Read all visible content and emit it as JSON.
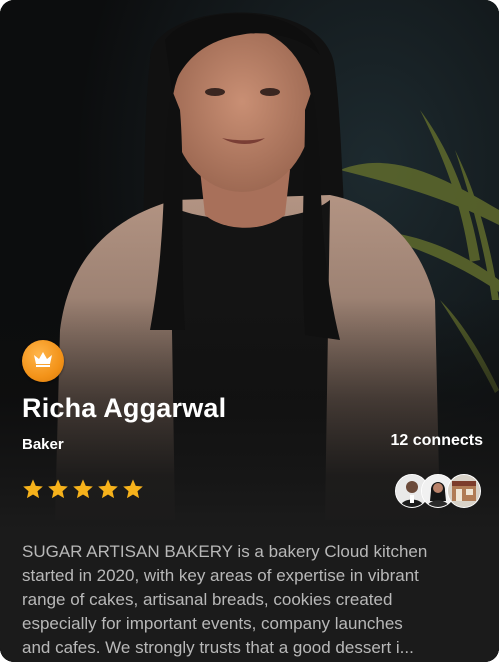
{
  "profile": {
    "name": "Richa Aggarwal",
    "role": "Baker",
    "connects": "12 connects",
    "rating": 5,
    "badge_icon": "crown-icon",
    "connection_avatars": [
      "avatar-man",
      "avatar-woman",
      "avatar-storefront"
    ],
    "description_lines": [
      "SUGAR ARTISAN BAKERY is a bakery Cloud kitchen",
      "started in 2020, with key areas of expertise in vibrant",
      "range of cakes, artisanal breads, cookies created",
      "especially for important events, company launches",
      "and cafes. We strongly trusts that a good dessert i..."
    ]
  },
  "colors": {
    "badge": "#f39319",
    "star": "#f6b21b",
    "card_bg": "#1b1b1b",
    "description_text": "#b8b8b8"
  }
}
